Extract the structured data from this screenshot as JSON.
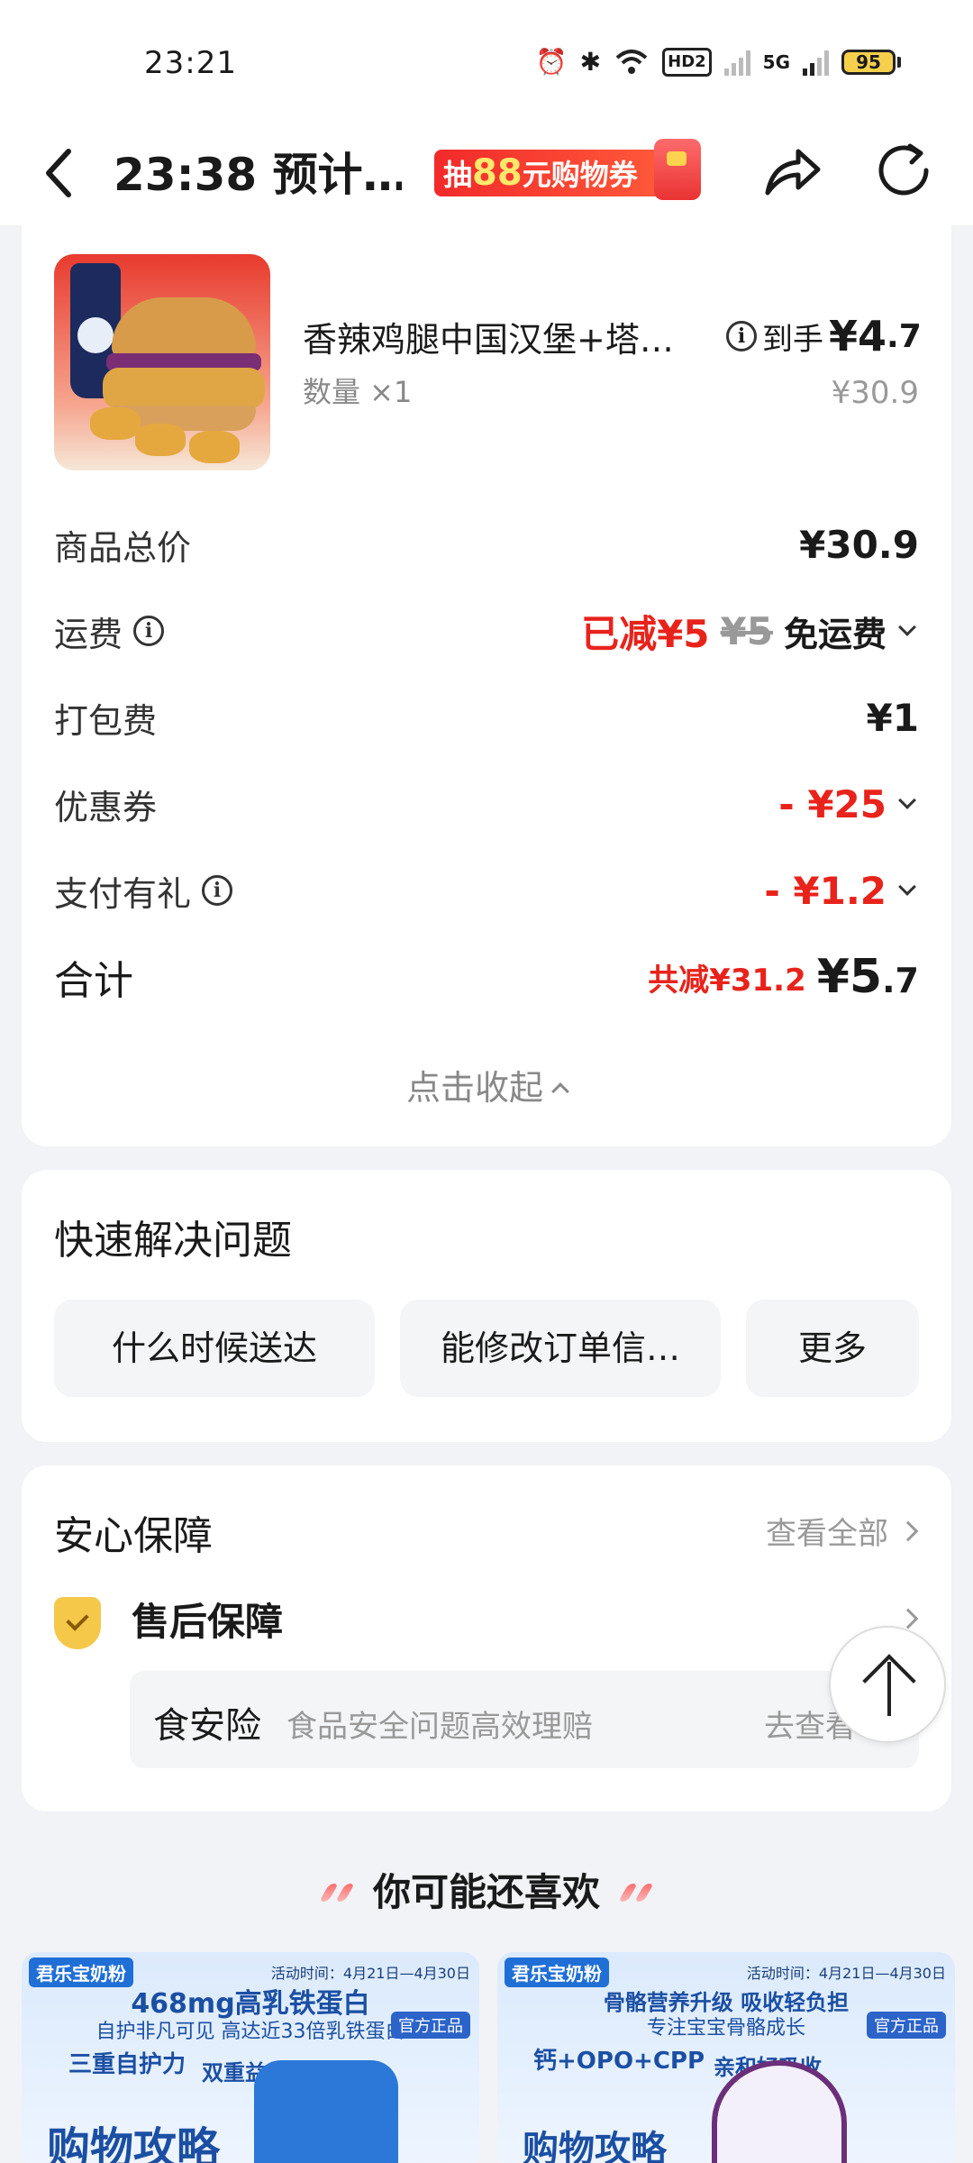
{
  "status": {
    "time": "23:21",
    "hd": "HD2",
    "net": "5G",
    "battery": "95"
  },
  "topbar": {
    "title": "23:38 预计…",
    "promo": {
      "pre": "抽",
      "num": "88",
      "post": "元购物券"
    }
  },
  "order": {
    "item_name": "香辣鸡腿中国汉堡+塔…",
    "quantity": "数量 ×1",
    "get_label": "到手",
    "get_price_int": "¥4",
    "get_price_dec": ".7",
    "original_price": "¥30.9"
  },
  "fees": {
    "goods_total_label": "商品总价",
    "goods_total": "¥30.9",
    "shipping_label": "运费",
    "shipping_reduced": "已减¥5",
    "shipping_orig": "¥5",
    "shipping_free": "免运费",
    "packing_label": "打包费",
    "packing": "¥1",
    "coupon_label": "优惠券",
    "coupon": "- ¥25",
    "pay_gift_label": "支付有礼",
    "pay_gift": "- ¥1.2",
    "total_label": "合计",
    "total_saved": "共减¥31.2",
    "total_int": "¥5",
    "total_dec": ".7",
    "collapse": "点击收起"
  },
  "quick": {
    "title": "快速解决问题",
    "buttons": [
      "什么时候送达",
      "能修改订单信…",
      "更多"
    ]
  },
  "guarantee": {
    "title": "安心保障",
    "view_all": "查看全部",
    "after_sale": "售后保障",
    "insurance_name": "食安险",
    "insurance_desc": "食品安全问题高效理赔",
    "insurance_go": "去查看"
  },
  "recommend": {
    "title": "你可能还喜欢",
    "ads": [
      {
        "brand": "君乐宝奶粉",
        "date": "活动时间：4月21日—4月30日",
        "h1": "468mg高乳铁蛋白",
        "h2": "自护非凡可见 高达近33倍乳铁蛋白",
        "h3": "三重自护力",
        "h4": "双重益生元",
        "big": "购物攻略",
        "tag": "官方正品"
      },
      {
        "brand": "君乐宝奶粉",
        "date": "活动时间：4月21日—4月30日",
        "h1": "骨骼营养升级 吸收轻负担",
        "h2": "专注宝宝骨骼成长",
        "h3": "钙+OPO+CPP",
        "h4": "亲和好吸收",
        "big": "购物攻略",
        "tag": "官方正品"
      }
    ]
  }
}
